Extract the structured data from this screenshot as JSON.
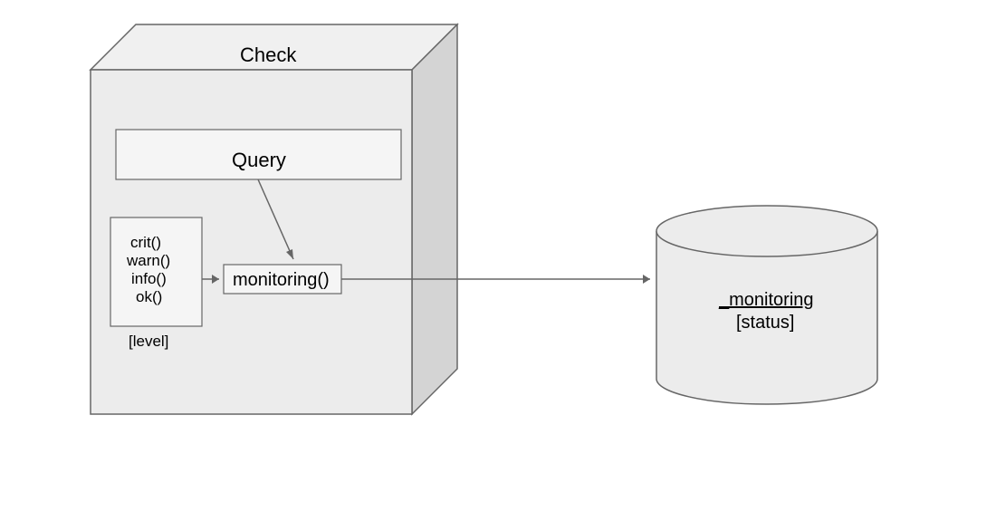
{
  "diagram": {
    "cube_title": "Check",
    "query_box": "Query",
    "level_box": {
      "items": [
        "crit()",
        "warn()",
        "info()",
        "ok()"
      ],
      "label": "[level]"
    },
    "monitoring_fn": "monitoring()",
    "datastore": {
      "name": "_monitoring",
      "status": "[status]"
    }
  },
  "colors": {
    "cube_front": "#ececec",
    "cube_top": "#f0f0f0",
    "cube_side": "#d4d4d4",
    "box_fill": "#f5f5f5",
    "cylinder_fill": "#ececec",
    "stroke": "#666666"
  }
}
